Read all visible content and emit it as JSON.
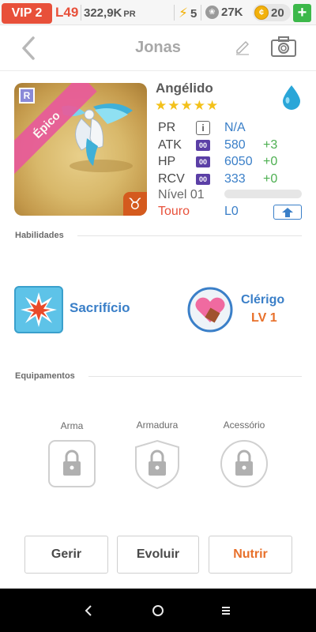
{
  "topbar": {
    "vip": "VIP 2",
    "level": "L49",
    "power": "322,9K",
    "power_unit": "PR",
    "energy": "5",
    "paws": "27K",
    "coins": "20",
    "plus": "+"
  },
  "header": {
    "title": "Jonas"
  },
  "monster": {
    "rarity_letter": "R",
    "rarity": "Épico",
    "zodiac_symbol": "♉",
    "name": "Angélido",
    "stars": "★★★★★",
    "element": "water",
    "stats": {
      "pr_label": "PR",
      "pr_value": "N/A",
      "atk_label": "ATK",
      "atk_value": "580",
      "atk_bonus": "+3",
      "hp_label": "HP",
      "hp_value": "6050",
      "hp_bonus": "+0",
      "rcv_label": "RCV",
      "rcv_value": "333",
      "rcv_bonus": "+0",
      "oo_tag": "00"
    },
    "level_label": "Nível 01",
    "level_progress": 0,
    "zodiac_name": "Touro",
    "link_level": "L0"
  },
  "skills": {
    "title": "Habilidades",
    "skill_name": "Sacrifício",
    "class_name": "Clérigo",
    "class_level": "LV 1"
  },
  "equipment": {
    "title": "Equipamentos",
    "slots": [
      "Arma",
      "Armadura",
      "Acessório"
    ]
  },
  "actions": {
    "manage": "Gerir",
    "evolve": "Evoluir",
    "feed": "Nutrir"
  },
  "colors": {
    "accent_blue": "#3a7fc8",
    "accent_red": "#e8503a",
    "bonus_green": "#4caf50",
    "feed_orange": "#e8702a"
  }
}
